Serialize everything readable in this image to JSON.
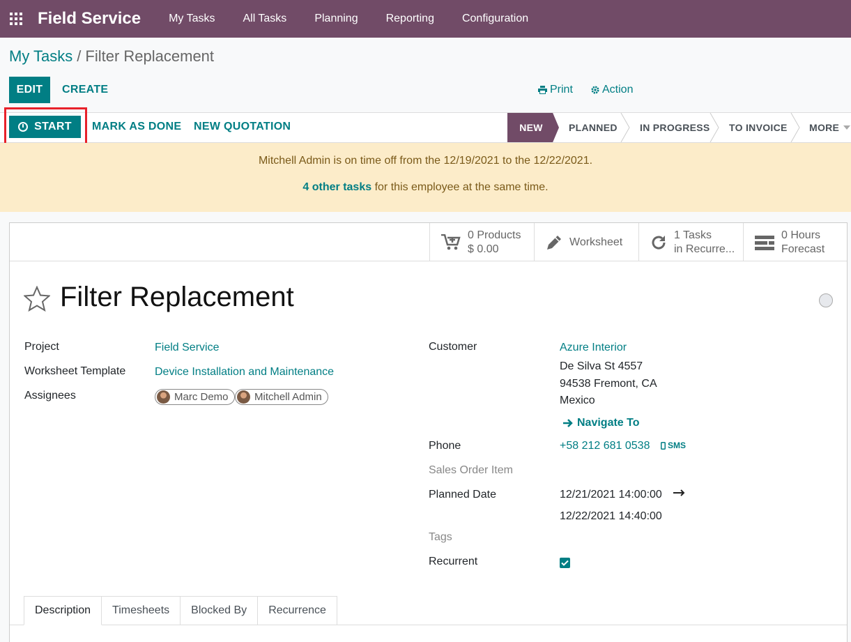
{
  "navbar": {
    "app_name": "Field Service",
    "items": [
      "My Tasks",
      "All Tasks",
      "Planning",
      "Reporting",
      "Configuration"
    ],
    "bg_color": "#714b67"
  },
  "breadcrumb": {
    "parent": "My Tasks",
    "separator": "/",
    "current": "Filter Replacement"
  },
  "controls": {
    "edit_label": "EDIT",
    "create_label": "CREATE",
    "print_label": "Print",
    "action_label": "Action"
  },
  "statusbar": {
    "start_label": "START",
    "mark_done_label": "MARK AS DONE",
    "new_quotation_label": "NEW QUOTATION",
    "stages": [
      "NEW",
      "PLANNED",
      "IN PROGRESS",
      "TO INVOICE",
      "MORE"
    ],
    "active_stage": "NEW"
  },
  "alert": {
    "line1": "Mitchell Admin is on time off from the 12/19/2021 to the 12/22/2021.",
    "line2_link": "4 other tasks",
    "line2_rest": " for this employee at the same time."
  },
  "smart_buttons": {
    "products": {
      "value": "0 Products",
      "sub": "$ 0.00"
    },
    "worksheet": {
      "label": "Worksheet"
    },
    "tasks": {
      "value": "1 Tasks",
      "sub": "in Recurre..."
    },
    "hours": {
      "value": "0  Hours",
      "sub": "Forecast"
    }
  },
  "task": {
    "title": "Filter Replacement",
    "project_label": "Project",
    "project_value": "Field Service",
    "worksheet_label": "Worksheet Template",
    "worksheet_value": "Device Installation and Maintenance",
    "assignees_label": "Assignees",
    "assignees": [
      "Marc Demo",
      "Mitchell Admin"
    ],
    "customer_label": "Customer",
    "customer_name": "Azure Interior",
    "customer_address": [
      "De Silva St 4557",
      "94538 Fremont, CA",
      "Mexico"
    ],
    "navigate_label": "Navigate To",
    "phone_label": "Phone",
    "phone_value": "+58 212 681 0538",
    "sms_label": "SMS",
    "sales_order_label": "Sales Order Item",
    "planned_date_label": "Planned Date",
    "planned_start": "12/21/2021 14:00:00",
    "planned_end": "12/22/2021 14:40:00",
    "tags_label": "Tags",
    "recurrent_label": "Recurrent",
    "recurrent_checked": true
  },
  "tabs": [
    "Description",
    "Timesheets",
    "Blocked By",
    "Recurrence"
  ],
  "active_tab": "Description",
  "colors": {
    "primary": "#017e84",
    "highlight": "#e8212a",
    "alert_bg": "#fcecc9"
  }
}
